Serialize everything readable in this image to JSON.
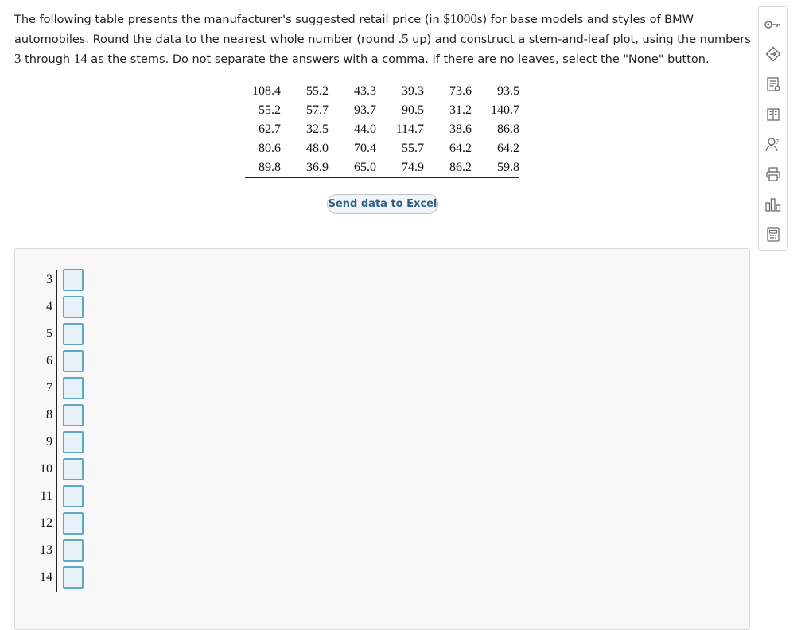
{
  "question": {
    "part1": "The following table presents the manufacturer's suggested retail price (in ",
    "unit": "$1000s",
    "part2": ") for base models and styles of BMW automobiles. Round the data to the nearest whole number (round ",
    "round_value": ".5",
    "part3": " up) and construct a stem-and-leaf plot, using the numbers ",
    "stem_first": "3",
    "part4": " through ",
    "stem_last": "14",
    "part5": " as the stems. Do not separate the answers with a comma. If there are no leaves, select the \"None\" button."
  },
  "data_table": {
    "rows": [
      [
        "108.4",
        "55.2",
        "43.3",
        "39.3",
        "73.6",
        "93.5"
      ],
      [
        "55.2",
        "57.7",
        "93.7",
        "90.5",
        "31.2",
        "140.7"
      ],
      [
        "62.7",
        "32.5",
        "44.0",
        "114.7",
        "38.6",
        "86.8"
      ],
      [
        "80.6",
        "48.0",
        "70.4",
        "55.7",
        "64.2",
        "64.2"
      ],
      [
        "89.8",
        "36.9",
        "65.0",
        "74.9",
        "86.2",
        "59.8"
      ]
    ]
  },
  "excel_button": {
    "label": "Send data to Excel"
  },
  "stem_leaf": {
    "stems": [
      "3",
      "4",
      "5",
      "6",
      "7",
      "8",
      "9",
      "10",
      "11",
      "12",
      "13",
      "14"
    ],
    "leaves": [
      "",
      "",
      "",
      "",
      "",
      "",
      "",
      "",
      "",
      "",
      "",
      ""
    ]
  },
  "toolbar": {
    "items": [
      "key-icon",
      "review-icon",
      "checklist-icon",
      "textbook-icon",
      "ask-instructor-icon",
      "print-icon",
      "statistics-icon",
      "calculator-icon"
    ]
  },
  "colors": {
    "leaf_border": "#5fa8c6",
    "leaf_fill": "#e6f1f8",
    "button_text": "#2d5f8a",
    "icon_gray": "#6b6b6b"
  }
}
